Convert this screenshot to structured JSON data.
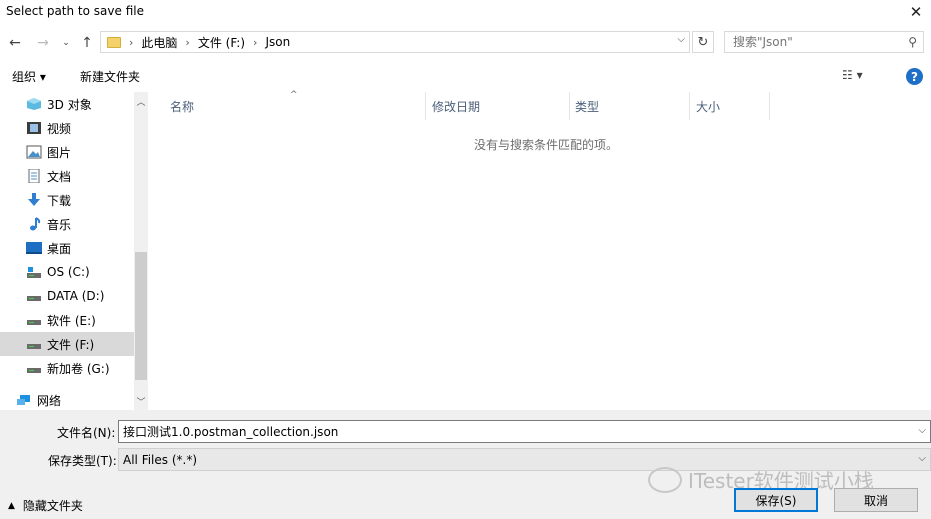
{
  "window": {
    "title": "Select path to save file"
  },
  "address": {
    "crumbs": [
      "此电脑",
      "文件 (F:)",
      "Json"
    ]
  },
  "search": {
    "placeholder": "搜索\"Json\""
  },
  "toolbar": {
    "organize": "组织 ▾",
    "new_folder": "新建文件夹"
  },
  "sidebar": {
    "items": [
      {
        "label": "3D 对象",
        "icon": "cube-icon"
      },
      {
        "label": "视频",
        "icon": "video-icon"
      },
      {
        "label": "图片",
        "icon": "picture-icon"
      },
      {
        "label": "文档",
        "icon": "document-icon"
      },
      {
        "label": "下载",
        "icon": "download-icon"
      },
      {
        "label": "音乐",
        "icon": "music-icon"
      },
      {
        "label": "桌面",
        "icon": "desktop-icon"
      },
      {
        "label": "OS (C:)",
        "icon": "drive-icon"
      },
      {
        "label": "DATA (D:)",
        "icon": "drive-icon"
      },
      {
        "label": "软件 (E:)",
        "icon": "drive-icon"
      },
      {
        "label": "文件 (F:)",
        "icon": "drive-icon",
        "selected": true
      },
      {
        "label": "新加卷 (G:)",
        "icon": "drive-icon"
      },
      {
        "label": "网络",
        "icon": "network-icon"
      }
    ]
  },
  "filelist": {
    "columns": [
      "名称",
      "修改日期",
      "类型",
      "大小"
    ],
    "empty_message": "没有与搜索条件匹配的项。"
  },
  "form": {
    "filename_label": "文件名(N):",
    "filename_value": "接口测试1.0.postman_collection.json",
    "filetype_label": "保存类型(T):",
    "filetype_value": "All Files (*.*)"
  },
  "footer": {
    "hide_folders": "隐藏文件夹",
    "save": "保存(S)",
    "cancel": "取消"
  },
  "watermark": "ITester软件测试小栈"
}
